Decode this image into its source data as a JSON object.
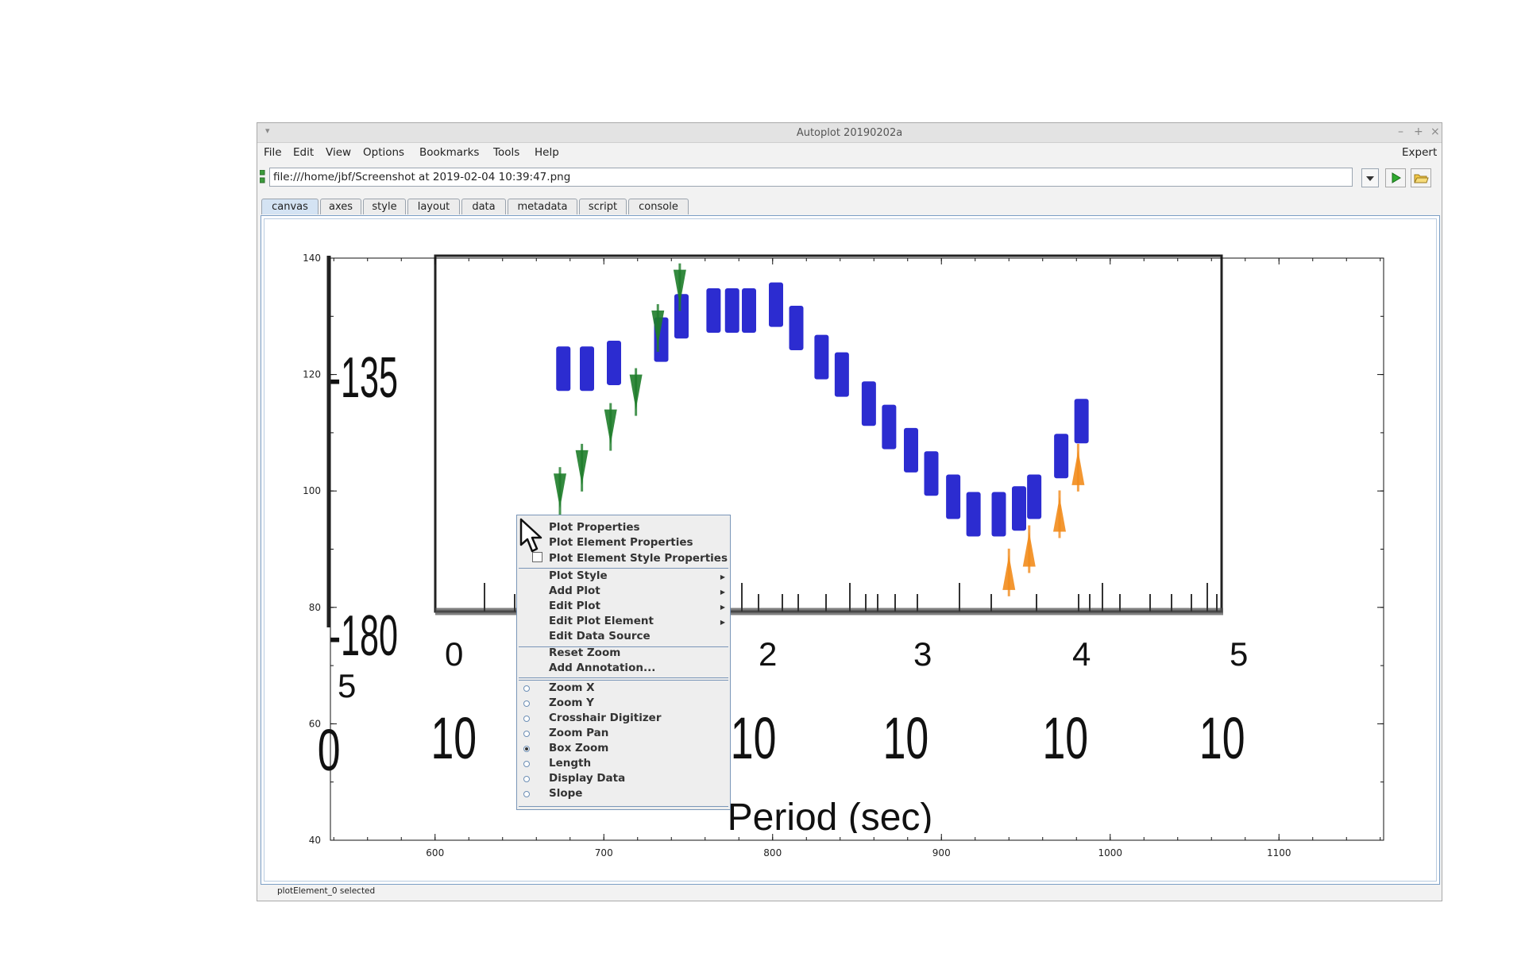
{
  "window": {
    "title": "Autoplot 20190202a"
  },
  "menu": {
    "items": [
      "File",
      "Edit",
      "View",
      "Options",
      "Bookmarks",
      "Tools",
      "Help"
    ],
    "expert": "Expert"
  },
  "url": {
    "value": "file:///home/jbf/Screenshot at 2019-02-04 10:39:47.png"
  },
  "tabs": [
    "canvas",
    "axes",
    "style",
    "layout",
    "data",
    "metadata",
    "script",
    "console"
  ],
  "status": {
    "text": "plotElement_0 selected"
  },
  "plot": {
    "x_ticks": [
      "600",
      "700",
      "800",
      "900",
      "1000",
      "1100"
    ],
    "y_ticks": [
      "140",
      "120",
      "100",
      "80",
      "60",
      "40"
    ]
  },
  "chart_data": {
    "type": "scatter",
    "xlim": [
      538,
      1162
    ],
    "ylim": [
      40,
      140
    ],
    "x_ticks": [
      600,
      700,
      800,
      900,
      1000,
      1100
    ],
    "y_ticks": [
      40,
      60,
      80,
      100,
      120,
      140
    ],
    "grid": false,
    "image_text": {
      "y_labels": [
        "-135",
        "-180"
      ],
      "x_labels": [
        "10",
        "10",
        "10",
        "10"
      ],
      "exponents": [
        "5",
        "0",
        "2",
        "3",
        "4",
        "5"
      ],
      "axis_label": "Period (sec)"
    },
    "series": [
      {
        "color": "#1a1acc",
        "points": [
          [
            676,
            121
          ],
          [
            690,
            121
          ],
          [
            706,
            122
          ],
          [
            734,
            126
          ],
          [
            746,
            130
          ],
          [
            765,
            131
          ],
          [
            776,
            131
          ],
          [
            786,
            131
          ],
          [
            802,
            132
          ],
          [
            814,
            128
          ],
          [
            829,
            123
          ],
          [
            841,
            120
          ],
          [
            857,
            115
          ],
          [
            869,
            111
          ],
          [
            882,
            107
          ],
          [
            894,
            103
          ],
          [
            907,
            99
          ],
          [
            919,
            96
          ],
          [
            934,
            96
          ],
          [
            946,
            97
          ],
          [
            955,
            99
          ],
          [
            971,
            106
          ],
          [
            983,
            112
          ]
        ]
      },
      {
        "color": "#1e7d2a",
        "points": [
          [
            674,
            100
          ],
          [
            687,
            104
          ],
          [
            704,
            111
          ],
          [
            719,
            117
          ],
          [
            732,
            128
          ],
          [
            745,
            135
          ]
        ]
      },
      {
        "color": "#f28c1c",
        "points": [
          [
            940,
            86
          ],
          [
            952,
            90
          ],
          [
            970,
            96
          ],
          [
            981,
            104
          ]
        ]
      }
    ]
  },
  "context_menu": {
    "plot_properties": "Plot Properties",
    "plot_element_properties": "Plot Element Properties",
    "plot_element_style_properties": "Plot Element Style Properties",
    "plot_style": "Plot Style",
    "add_plot": "Add Plot",
    "edit_plot": "Edit Plot",
    "edit_plot_element": "Edit Plot Element",
    "edit_data_source": "Edit Data Source",
    "reset_zoom": "Reset Zoom",
    "add_annotation": "Add Annotation...",
    "modes": [
      "Zoom X",
      "Zoom Y",
      "Crosshair Digitizer",
      "Zoom Pan",
      "Box Zoom",
      "Length",
      "Display Data",
      "Slope"
    ],
    "selected_mode": "Box Zoom"
  }
}
